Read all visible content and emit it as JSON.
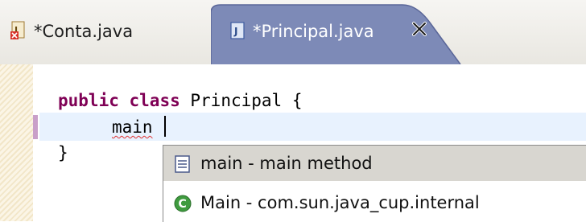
{
  "tabs": [
    {
      "label": "*Conta.java",
      "active": false,
      "icon": "java-file-error-icon"
    },
    {
      "label": "*Principal.java",
      "active": true,
      "icon": "java-file-icon",
      "closable": true
    }
  ],
  "editor": {
    "lines": {
      "keyword_public": "public",
      "keyword_class": "class",
      "class_decl_rest": "Principal {",
      "typed_text": "main",
      "closing_brace": "}"
    }
  },
  "content_assist": {
    "proposals": [
      {
        "label": "main - main method",
        "icon": "template-icon",
        "selected": true
      },
      {
        "label": "Main - com.sun.java_cup.internal",
        "icon": "class-icon",
        "selected": false
      }
    ]
  },
  "colors": {
    "active_tab": "#7d8ab7",
    "keyword": "#7f0055",
    "current_line": "#e8f2fe",
    "selected_proposal": "#d8d6d0"
  }
}
